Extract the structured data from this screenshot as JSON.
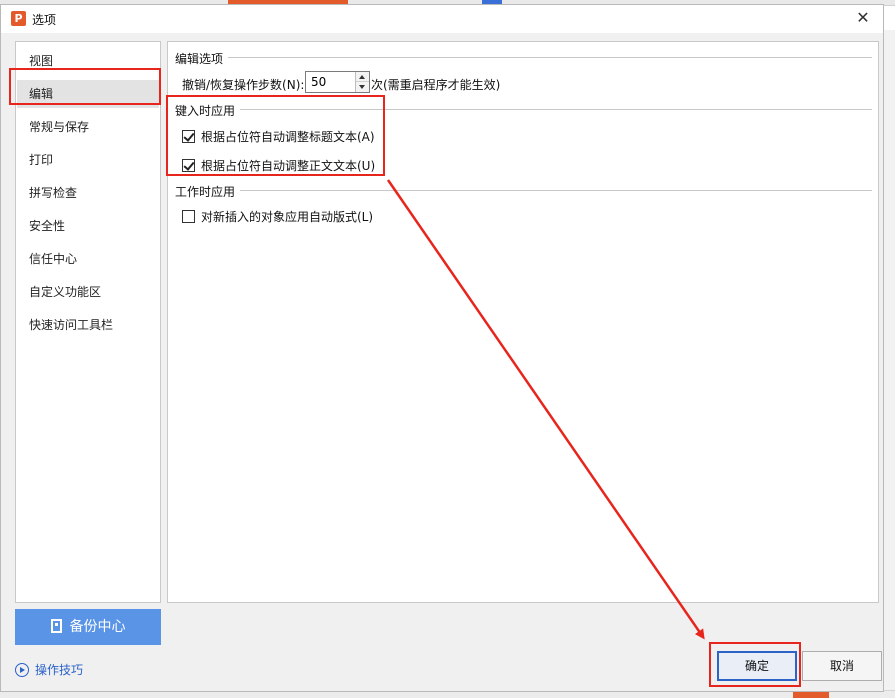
{
  "dialog": {
    "title": "选项",
    "app_icon": "P",
    "close_label": "✕"
  },
  "nav": {
    "items": [
      {
        "label": "视图"
      },
      {
        "label": "编辑",
        "selected": true
      },
      {
        "label": "常规与保存"
      },
      {
        "label": "打印"
      },
      {
        "label": "拼写检查"
      },
      {
        "label": "安全性"
      },
      {
        "label": "信任中心"
      },
      {
        "label": "自定义功能区"
      },
      {
        "label": "快速访问工具栏"
      }
    ],
    "backup_label": "备份中心",
    "tips_label": "操作技巧"
  },
  "edit_options": {
    "group_title": "编辑选项",
    "undo_label": "撤销/恢复操作步数(N):",
    "undo_value": "50",
    "undo_note": "次(需重启程序才能生效)"
  },
  "typing": {
    "group_title": "键入时应用",
    "options": [
      {
        "label": "根据占位符自动调整标题文本(A)",
        "checked": true
      },
      {
        "label": "根据占位符自动调整正文文本(U)",
        "checked": true
      }
    ]
  },
  "working": {
    "group_title": "工作时应用",
    "options": [
      {
        "label": "对新插入的对象应用自动版式(L)",
        "checked": false
      }
    ]
  },
  "buttons": {
    "ok_label": "确定",
    "cancel_label": "取消"
  },
  "colors": {
    "annotation_red": "#e8251c",
    "backup_blue": "#5a94e6",
    "brand_orange": "#e35b2a"
  },
  "icons": {
    "app": "wps-presentation-icon",
    "close": "close-icon",
    "backup": "document-icon",
    "tips": "play-circle-icon"
  }
}
